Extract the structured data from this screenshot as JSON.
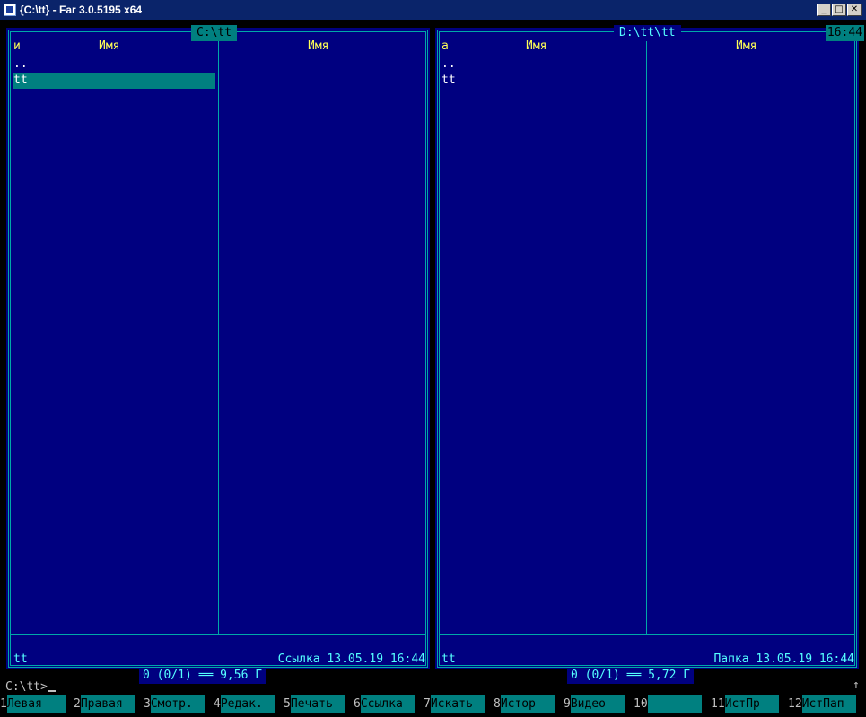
{
  "window": {
    "title": "{C:\\tt} - Far 3.0.5195 x64"
  },
  "left_panel": {
    "path": "C:\\tt",
    "sort_indicator": "и",
    "columns": [
      "Имя",
      "Имя"
    ],
    "files": [
      {
        "name": ".."
      },
      {
        "name": "tt",
        "selected": true
      }
    ],
    "info_name": "tt",
    "info_detail": "Ссылка 13.05.19 16:44",
    "stats": "0 (0/1) ══ 9,56 Г"
  },
  "right_panel": {
    "path": "D:\\tt\\tt",
    "clock": "16:44",
    "sort_indicator": "a",
    "columns": [
      "Имя",
      "Имя"
    ],
    "files": [
      {
        "name": ".."
      },
      {
        "name": "tt"
      }
    ],
    "info_name": "tt",
    "info_detail": "Папка 13.05.19 16:44",
    "stats": "0 (0/1) ══ 5,72 Г"
  },
  "command_line": {
    "prompt": "C:\\tt>",
    "scroll_indicator": "↑"
  },
  "keybar": [
    {
      "num": "1",
      "label": "Левая"
    },
    {
      "num": "2",
      "label": "Правая"
    },
    {
      "num": "3",
      "label": "Смотр."
    },
    {
      "num": "4",
      "label": "Редак."
    },
    {
      "num": "5",
      "label": "Печать"
    },
    {
      "num": "6",
      "label": "Ссылка"
    },
    {
      "num": "7",
      "label": "Искать"
    },
    {
      "num": "8",
      "label": "Истор"
    },
    {
      "num": "9",
      "label": "Видео"
    },
    {
      "num": "10",
      "label": ""
    },
    {
      "num": "11",
      "label": "ИстПр"
    },
    {
      "num": "12",
      "label": "ИстПап"
    }
  ]
}
